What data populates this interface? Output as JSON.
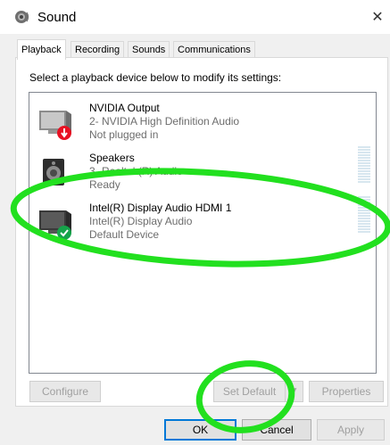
{
  "window": {
    "title": "Sound",
    "close_glyph": "✕"
  },
  "tabs": [
    {
      "label": "Playback",
      "active": true
    },
    {
      "label": "Recording",
      "active": false
    },
    {
      "label": "Sounds",
      "active": false
    },
    {
      "label": "Communications",
      "active": false
    }
  ],
  "instruction": "Select a playback device below to modify its settings:",
  "devices": [
    {
      "name": "NVIDIA Output",
      "description": "2- NVIDIA High Definition Audio",
      "status": "Not plugged in",
      "icon": "monitor-icon",
      "badge": "red-down-arrow-badge"
    },
    {
      "name": "Speakers",
      "description": "3- Realtek(R) Audio",
      "status": "Ready",
      "icon": "speaker-icon",
      "badge": "none"
    },
    {
      "name": "Intel(R) Display Audio HDMI 1",
      "description": "Intel(R) Display Audio",
      "status": "Default Device",
      "icon": "monitor-icon",
      "badge": "green-check-badge"
    }
  ],
  "buttons": {
    "configure": "Configure",
    "set_default": "Set Default",
    "properties": "Properties",
    "ok": "OK",
    "cancel": "Cancel",
    "apply": "Apply"
  },
  "colors": {
    "highlight_green": "#22e01f",
    "focus_blue": "#0078d7",
    "badge_red": "#e81123",
    "badge_green": "#16a34a"
  }
}
